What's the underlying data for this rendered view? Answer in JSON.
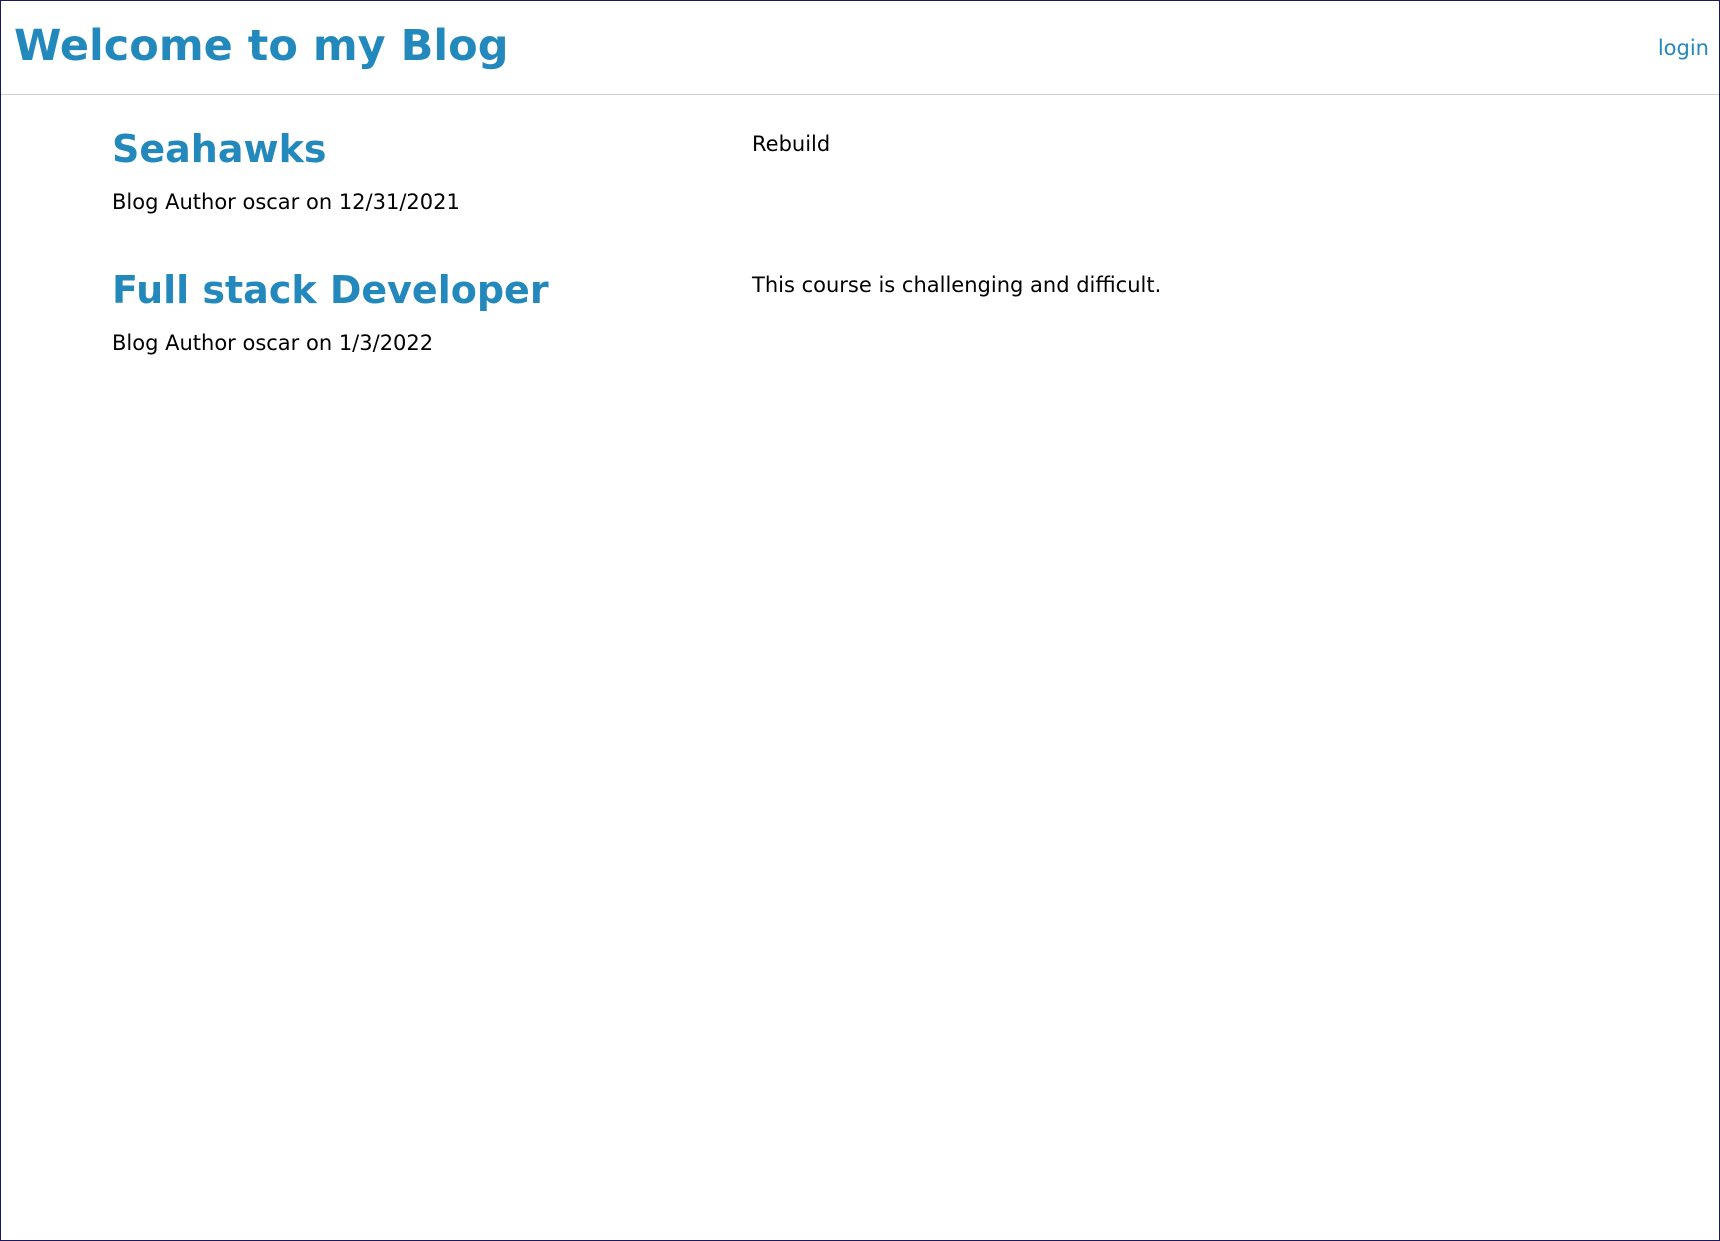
{
  "header": {
    "site_title": "Welcome to my Blog",
    "login_label": "login"
  },
  "posts": [
    {
      "title": "Seahawks",
      "meta": "Blog Author oscar on 12/31/2021",
      "body": "Rebuild"
    },
    {
      "title": "Full stack Developer",
      "meta": "Blog Author oscar on 1/3/2022",
      "body": "This course is challenging and difficult."
    }
  ],
  "colors": {
    "accent": "#2389bd",
    "text": "#000000",
    "divider": "#cfcfcf"
  }
}
